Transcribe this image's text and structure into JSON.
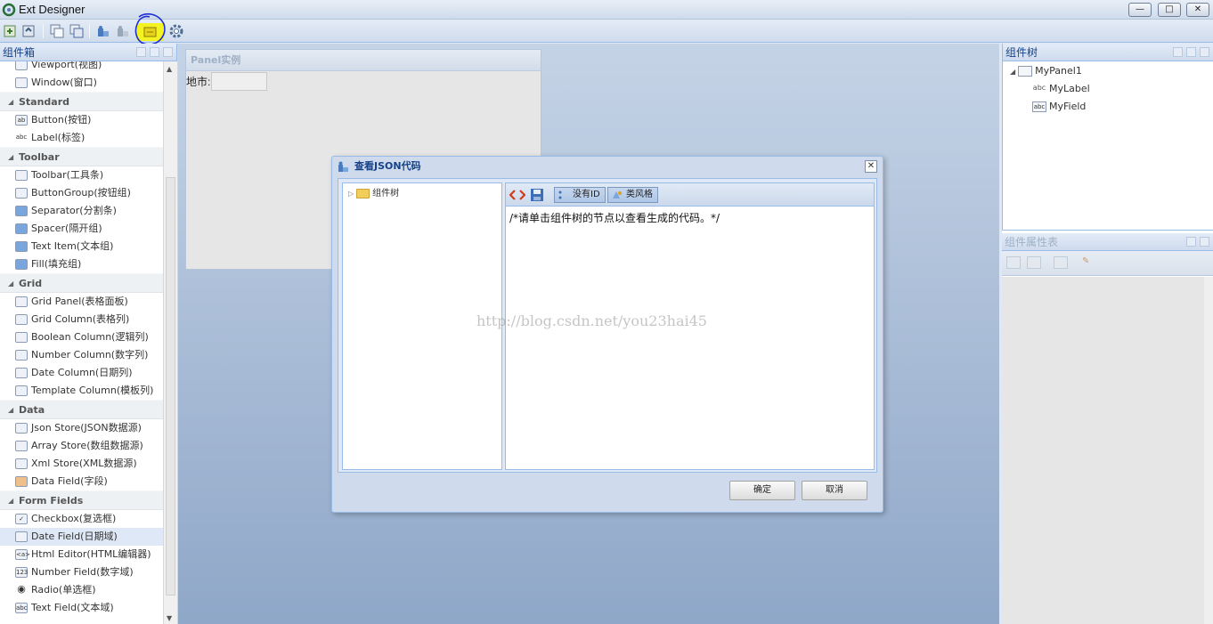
{
  "window": {
    "title": "Ext Designer",
    "min_label": "—",
    "max_label": "□",
    "close_label": "✕"
  },
  "toolbar": {
    "icons": [
      "new-project-icon",
      "open-project-icon",
      "copy-icon",
      "paste-icon",
      "puzzle-icon",
      "puzzle-gray-icon",
      "export-json-icon",
      "settings-gear-icon"
    ]
  },
  "left_panel": {
    "title": "组件箱",
    "items_top": [
      {
        "label": "Viewport(视图)",
        "icon": "viewport-icon"
      },
      {
        "label": "Window(窗口)",
        "icon": "window-icon"
      }
    ],
    "groups": [
      {
        "name": "Standard",
        "items": [
          {
            "label": "Button(按钮)",
            "icon": "button-icon",
            "glyph": "ab"
          },
          {
            "label": "Label(标签)",
            "icon": "label-icon",
            "glyph": "abc"
          }
        ]
      },
      {
        "name": "Toolbar",
        "items": [
          {
            "label": "Toolbar(工具条)",
            "icon": "toolbar-icon"
          },
          {
            "label": "ButtonGroup(按钮组)",
            "icon": "buttongroup-icon"
          },
          {
            "label": "Separator(分割条)",
            "icon": "puzzle-icon"
          },
          {
            "label": "Spacer(隔开组)",
            "icon": "puzzle-icon"
          },
          {
            "label": "Text Item(文本组)",
            "icon": "puzzle-icon"
          },
          {
            "label": "Fill(填充组)",
            "icon": "puzzle-icon"
          }
        ]
      },
      {
        "name": "Grid",
        "items": [
          {
            "label": "Grid Panel(表格面板)",
            "icon": "grid-icon"
          },
          {
            "label": "Grid Column(表格列)",
            "icon": "grid-column-icon"
          },
          {
            "label": "Boolean Column(逻辑列)",
            "icon": "boolean-column-icon"
          },
          {
            "label": "Number Column(数字列)",
            "icon": "number-column-icon"
          },
          {
            "label": "Date Column(日期列)",
            "icon": "date-column-icon"
          },
          {
            "label": "Template Column(模板列)",
            "icon": "template-column-icon"
          }
        ]
      },
      {
        "name": "Data",
        "items": [
          {
            "label": "Json Store(JSON数据源)",
            "icon": "json-store-icon"
          },
          {
            "label": "Array Store(数组数据源)",
            "icon": "array-store-icon"
          },
          {
            "label": "Xml Store(XML数据源)",
            "icon": "xml-store-icon"
          },
          {
            "label": "Data Field(字段)",
            "icon": "data-field-icon"
          }
        ]
      },
      {
        "name": "Form Fields",
        "items": [
          {
            "label": "Checkbox(复选框)",
            "icon": "checkbox-icon",
            "glyph": "✓"
          },
          {
            "label": "Date Field(日期域)",
            "icon": "date-field-icon",
            "selected": true
          },
          {
            "label": "Html Editor(HTML编辑器)",
            "icon": "html-editor-icon",
            "glyph": "<a>"
          },
          {
            "label": "Number Field(数字域)",
            "icon": "number-field-icon",
            "glyph": "123"
          },
          {
            "label": "Radio(单选框)",
            "icon": "radio-icon",
            "glyph": "◉"
          },
          {
            "label": "Text Field(文本域)",
            "icon": "text-field-icon",
            "glyph": "abc"
          }
        ]
      }
    ]
  },
  "canvas": {
    "panel_title": "Panel实例",
    "field_label": "地市:",
    "field_value": ""
  },
  "component_tree": {
    "title": "组件树",
    "nodes": [
      {
        "label": "MyPanel1",
        "icon": "panel-icon"
      },
      {
        "label": "MyLabel",
        "icon": "label-icon",
        "glyph": "abc"
      },
      {
        "label": "MyField",
        "icon": "text-field-icon",
        "glyph": "abc"
      }
    ]
  },
  "properties": {
    "title": "组件属性表"
  },
  "dialog": {
    "title": "查看JSON代码",
    "close_label": "✕",
    "tree_root": "组件树",
    "toolbar": {
      "no_id_label": "没有ID",
      "class_style_label": "类风格"
    },
    "code_text": "/*请单击组件树的节点以查看生成的代码。*/",
    "ok_label": "确定",
    "cancel_label": "取消"
  },
  "watermark": "http://blog.csdn.net/you23hai45",
  "colors": {
    "header_text": "#15428b",
    "border": "#99bbe8",
    "highlight": "#f3f321",
    "annotation": "#1e2dd4"
  }
}
